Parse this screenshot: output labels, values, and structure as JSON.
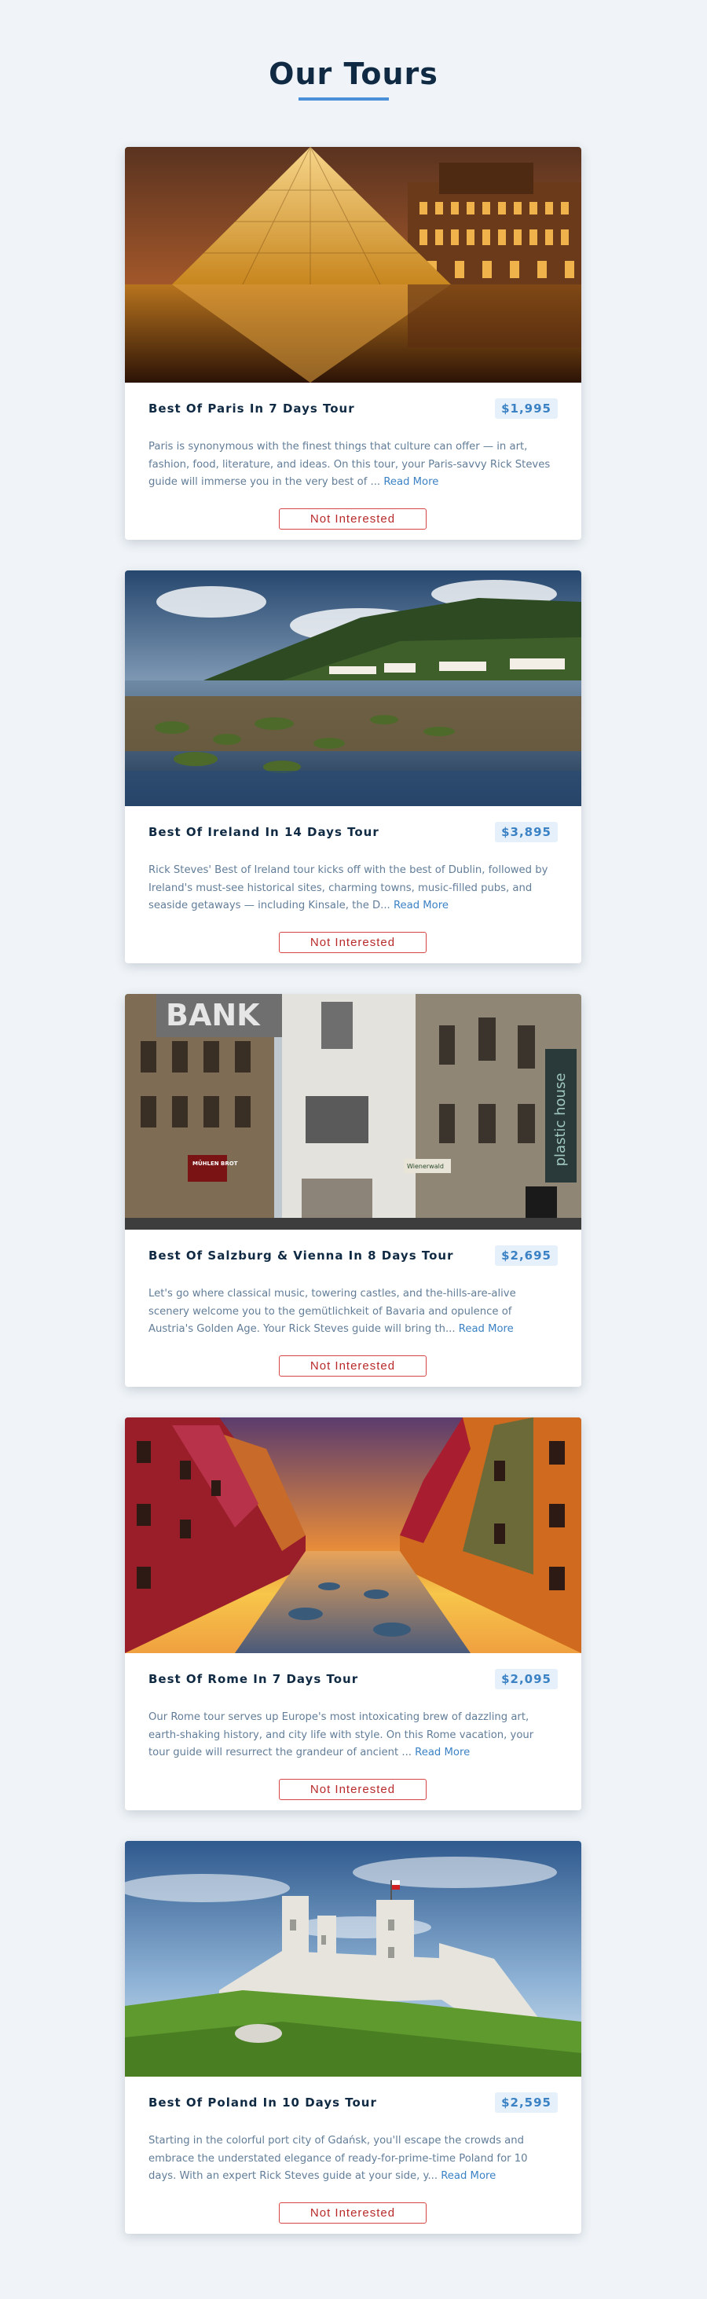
{
  "header": {
    "title": "Our Tours"
  },
  "tours": [
    {
      "name": "Best Of Paris In 7 Days Tour",
      "price": "$1,995",
      "info": "Paris is synonymous with the finest things that culture can offer — in art, fashion, food, literature, and ideas. On this tour, your Paris-savvy Rick Steves guide will immerse you in the very best of ...",
      "read_more": "Read More",
      "button": "Not Interested",
      "image": "paris-louvre-pyramid-photo"
    },
    {
      "name": "Best Of Ireland In 14 Days Tour",
      "price": "$3,895",
      "info": "Rick Steves' Best of Ireland tour kicks off with the best of Dublin, followed by Ireland's must-see historical sites, charming towns, music-filled pubs, and seaside getaways — including Kinsale, the D...",
      "read_more": "Read More",
      "button": "Not Interested",
      "image": "ireland-coast-photo"
    },
    {
      "name": "Best Of Salzburg & Vienna In 8 Days Tour",
      "price": "$2,695",
      "info": "Let's go where classical music, towering castles, and the-hills-are-alive scenery welcome you to the gemütlichkeit of Bavaria and opulence of Austria's Golden Age. Your Rick Steves guide will bring th...",
      "read_more": "Read More",
      "button": "Not Interested",
      "image": "vienna-street-photo",
      "signs": {
        "bank": "BANK",
        "bakery": "MÜHLEN BROT",
        "shop": "Wienerwald",
        "vertical": "plastic house"
      }
    },
    {
      "name": "Best Of Rome In 7 Days Tour",
      "price": "$2,095",
      "info": "Our Rome tour serves up Europe's most intoxicating brew of dazzling art, earth-shaking history, and city life with style. On this Rome vacation, your tour guide will resurrect the grandeur of ancient ...",
      "read_more": "Read More",
      "button": "Not Interested",
      "image": "canal-sunset-photo"
    },
    {
      "name": "Best Of Poland In 10 Days Tour",
      "price": "$2,595",
      "info": "Starting in the colorful port city of Gdańsk, you'll escape the crowds and embrace the understated elegance of ready-for-prime-time Poland for 10 days. With an expert Rick Steves guide at your side, y...",
      "read_more": "Read More",
      "button": "Not Interested",
      "image": "poland-castle-ruins-photo"
    }
  ],
  "colors": {
    "background": "#f0f4f8",
    "title": "#102a43",
    "accent": "#4a90d9",
    "price_text": "#3b82c4",
    "price_bg": "#e6f0fb",
    "body_text": "#627d98",
    "danger": "#d64545"
  }
}
